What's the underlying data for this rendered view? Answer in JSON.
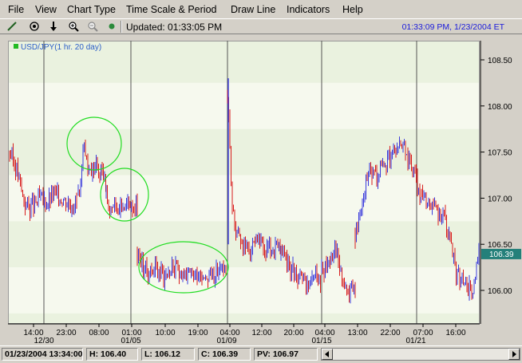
{
  "menu": {
    "items": [
      "File",
      "View",
      "Chart Type",
      "Time Scale & Period",
      "Draw Line",
      "Indicators",
      "Help"
    ]
  },
  "toolbar": {
    "updated_label": "Updated: 01:33:05 PM",
    "clock": "01:33:09 PM, 1/23/2004 ET",
    "icons": [
      "draw-line-icon",
      "crosshair-icon",
      "down-arrow-icon",
      "zoom-in-icon",
      "zoom-out-icon",
      "record-icon"
    ]
  },
  "chart": {
    "legend": "USD/JPY(1 hr. 20 day)",
    "current_price": "106.39",
    "colors": {
      "up": "#3a3adc",
      "down": "#d81c1c",
      "bg_band_a": "#f6f9ee",
      "bg_band_b": "#eaf2df",
      "annotation": "#22dd22",
      "price_tag": "#24807a"
    }
  },
  "chart_data": {
    "type": "line",
    "ylim": [
      105.7,
      108.6
    ],
    "y_ticks": [
      "108.50",
      "108.00",
      "107.50",
      "107.00",
      "106.50",
      "106.00"
    ],
    "y_tick_values": [
      108.5,
      108.0,
      107.5,
      107.0,
      106.5,
      106.0
    ],
    "x_tick_labels": [
      "14:00",
      "23:00",
      "08:00",
      "01:00",
      "10:00",
      "19:00",
      "04:00",
      "12:00",
      "20:00",
      "04:00",
      "13:00",
      "22:00",
      "07:00",
      "16:00"
    ],
    "x_date_labels": [
      "12/30",
      "01/05",
      "01/09",
      "01/15",
      "01/21"
    ],
    "session_dividers": 5,
    "series": [
      {
        "values": [
          107.5,
          107.3,
          106.95,
          106.9,
          107.0,
          106.95,
          107.05,
          107.0,
          106.95,
          106.95
        ]
      },
      {
        "values": [
          107.05,
          107.3,
          107.6,
          107.3,
          107.25,
          107.3,
          107.35,
          107.25,
          107.3,
          107.2
        ]
      },
      {
        "values": [
          107.0,
          106.9,
          106.95,
          106.9,
          106.95,
          106.9,
          106.9,
          106.95,
          106.9,
          106.95
        ]
      },
      {
        "values": [
          106.4,
          106.2,
          106.25,
          106.15,
          106.25,
          106.2,
          106.15,
          106.2,
          106.15,
          106.2,
          106.25
        ]
      },
      {
        "values": [
          108.1,
          106.8,
          106.6,
          106.5,
          106.45,
          106.45,
          106.5,
          106.4,
          106.45,
          106.45,
          106.45
        ]
      },
      {
        "values": [
          106.4,
          106.3,
          106.25,
          106.2,
          106.15,
          106.1,
          106.05,
          106.1,
          106.2,
          106.1
        ]
      },
      {
        "values": [
          106.2,
          106.3,
          106.5,
          106.1,
          105.95,
          106.0
        ]
      },
      {
        "values": [
          106.6,
          106.9,
          107.3,
          107.2,
          107.35,
          107.4,
          107.5,
          107.6,
          107.4,
          107.3,
          107.0
        ]
      },
      {
        "values": [
          107.1,
          107.0,
          106.9,
          106.85,
          106.8,
          106.5,
          106.2,
          106.1,
          106.05,
          105.95,
          106.4
        ]
      }
    ]
  },
  "status": {
    "date": "01/23/2004 13:34:00",
    "high": "H: 106.40",
    "low": "L: 106.12",
    "close": "C: 106.39",
    "pv": "PV: 106.97"
  }
}
